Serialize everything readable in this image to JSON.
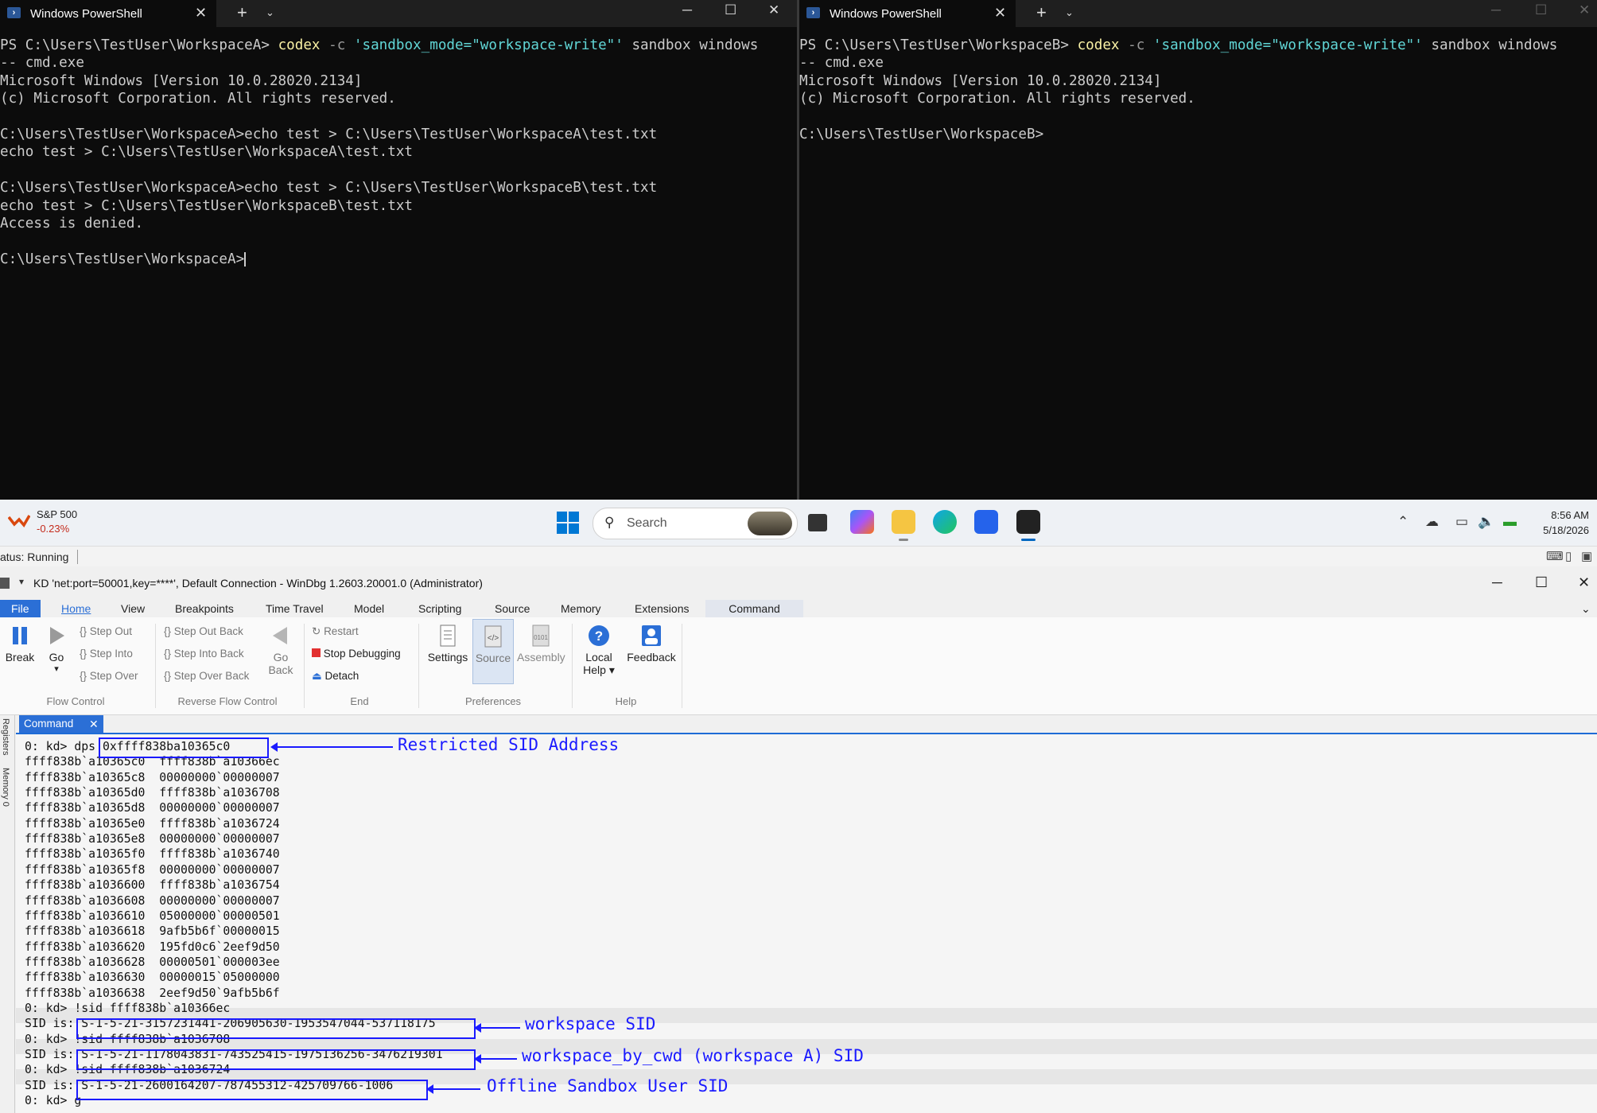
{
  "terminal_a": {
    "tab_title": "Windows PowerShell",
    "lines": [
      {
        "parts": [
          {
            "t": "PS C:\\Users\\TestUser\\WorkspaceA> ",
            "c": ""
          },
          {
            "t": "codex",
            "c": "cmd-y"
          },
          {
            "t": " -c ",
            "c": "cmd-g"
          },
          {
            "t": "'sandbox_mode=\"workspace-write\"'",
            "c": "cmd-s"
          },
          {
            "t": " sandbox windows",
            "c": ""
          }
        ]
      },
      {
        "parts": [
          {
            "t": "-- cmd.exe",
            "c": ""
          }
        ]
      },
      {
        "parts": [
          {
            "t": "Microsoft Windows [Version 10.0.28020.2134]",
            "c": ""
          }
        ]
      },
      {
        "parts": [
          {
            "t": "(c) Microsoft Corporation. All rights reserved.",
            "c": ""
          }
        ]
      },
      {
        "parts": [
          {
            "t": "",
            "c": ""
          }
        ]
      },
      {
        "parts": [
          {
            "t": "C:\\Users\\TestUser\\WorkspaceA>echo test > C:\\Users\\TestUser\\WorkspaceA\\test.txt",
            "c": ""
          }
        ]
      },
      {
        "parts": [
          {
            "t": "echo test > C:\\Users\\TestUser\\WorkspaceA\\test.txt",
            "c": ""
          }
        ]
      },
      {
        "parts": [
          {
            "t": "",
            "c": ""
          }
        ]
      },
      {
        "parts": [
          {
            "t": "C:\\Users\\TestUser\\WorkspaceA>echo test > C:\\Users\\TestUser\\WorkspaceB\\test.txt",
            "c": ""
          }
        ]
      },
      {
        "parts": [
          {
            "t": "echo test > C:\\Users\\TestUser\\WorkspaceB\\test.txt",
            "c": ""
          }
        ]
      },
      {
        "parts": [
          {
            "t": "Access is denied.",
            "c": ""
          }
        ]
      },
      {
        "parts": [
          {
            "t": "",
            "c": ""
          }
        ]
      },
      {
        "parts": [
          {
            "t": "C:\\Users\\TestUser\\WorkspaceA>",
            "c": ""
          }
        ],
        "cursor": true
      }
    ]
  },
  "terminal_b": {
    "tab_title": "Windows PowerShell",
    "lines": [
      {
        "parts": [
          {
            "t": "PS C:\\Users\\TestUser\\WorkspaceB> ",
            "c": ""
          },
          {
            "t": "codex",
            "c": "cmd-y"
          },
          {
            "t": " -c ",
            "c": "cmd-g"
          },
          {
            "t": "'sandbox_mode=\"workspace-write\"'",
            "c": "cmd-s"
          },
          {
            "t": " sandbox windows",
            "c": ""
          }
        ]
      },
      {
        "parts": [
          {
            "t": "-- cmd.exe",
            "c": ""
          }
        ]
      },
      {
        "parts": [
          {
            "t": "Microsoft Windows [Version 10.0.28020.2134]",
            "c": ""
          }
        ]
      },
      {
        "parts": [
          {
            "t": "(c) Microsoft Corporation. All rights reserved.",
            "c": ""
          }
        ]
      },
      {
        "parts": [
          {
            "t": "",
            "c": ""
          }
        ]
      },
      {
        "parts": [
          {
            "t": "C:\\Users\\TestUser\\WorkspaceB>",
            "c": ""
          }
        ]
      }
    ]
  },
  "tab_controls": {
    "plus": "+",
    "dropdown": "⌄",
    "minimize": "─",
    "maximize": "☐",
    "close": "✕"
  },
  "taskbar": {
    "widget_title": "S&P 500",
    "widget_value": "-0.23%",
    "search_placeholder": "Search",
    "time": "8:56 AM",
    "date": "5/18/2026"
  },
  "status": {
    "text": "atus: Running"
  },
  "windbg": {
    "title": "KD 'net:port=50001,key=****', Default Connection  - WinDbg 1.2603.20001.0 (Administrator)",
    "menu": [
      "File",
      "Home",
      "View",
      "Breakpoints",
      "Time Travel",
      "Model",
      "Scripting",
      "Source",
      "Memory",
      "Extensions",
      "Command"
    ],
    "ribbon": {
      "break": "Break",
      "go": "Go",
      "step_out": "Step Out",
      "step_into": "Step Into",
      "step_over": "Step Over",
      "step_out_back": "Step Out Back",
      "step_into_back": "Step Into Back",
      "step_over_back": "Step Over Back",
      "go_back_1": "Go",
      "go_back_2": "Back",
      "restart": "Restart",
      "stop": "Stop Debugging",
      "detach": "Detach",
      "settings": "Settings",
      "source": "Source",
      "assembly": "Assembly",
      "local_help_1": "Local",
      "local_help_2": "Help",
      "feedback": "Feedback",
      "groups": [
        "Flow Control",
        "Reverse Flow Control",
        "End",
        "Preferences",
        "Help"
      ]
    },
    "side_rail": [
      "Registers",
      "Memory 0"
    ],
    "panel_tab": "Command",
    "command_lines": [
      "0: kd> dps 0xffff838ba10365c0",
      "ffff838b`a10365c0  ffff838b`a10366ec",
      "ffff838b`a10365c8  00000000`00000007",
      "ffff838b`a10365d0  ffff838b`a1036708",
      "ffff838b`a10365d8  00000000`00000007",
      "ffff838b`a10365e0  ffff838b`a1036724",
      "ffff838b`a10365e8  00000000`00000007",
      "ffff838b`a10365f0  ffff838b`a1036740",
      "ffff838b`a10365f8  00000000`00000007",
      "ffff838b`a1036600  ffff838b`a1036754",
      "ffff838b`a1036608  00000000`00000007",
      "ffff838b`a1036610  05000000`00000501",
      "ffff838b`a1036618  9afb5b6f`00000015",
      "ffff838b`a1036620  195fd0c6`2eef9d50",
      "ffff838b`a1036628  00000501`000003ee",
      "ffff838b`a1036630  00000015`05000000",
      "ffff838b`a1036638  2eef9d50`9afb5b6f",
      "0: kd> !sid ffff838b`a10366ec",
      "SID is: S-1-5-21-3157231441-206905630-1953547044-537118175",
      "0: kd> !sid ffff838b`a1036708",
      "SID is: S-1-5-21-1178043831-743525415-1975136256-3476219301",
      "0: kd> !sid ffff838b`a1036724",
      "SID is: S-1-5-21-2600164207-787455312-425709766-1006",
      "0: kd> g"
    ],
    "annotations": {
      "restricted": "Restricted SID Address",
      "workspace": "workspace SID",
      "workspace_by_cwd": "workspace_by_cwd (workspace A) SID",
      "offline": "Offline Sandbox User SID"
    }
  }
}
